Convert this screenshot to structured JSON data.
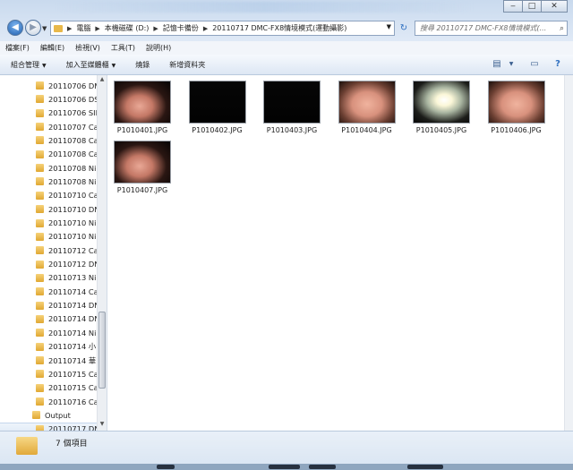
{
  "address": {
    "crumbs": [
      "電腦",
      "本機磁碟 (D:)",
      "記憶卡備份",
      "20110717 DMC-FX8情境模式(運動攝影)"
    ]
  },
  "search": {
    "placeholder": "搜尋 20110717 DMC-FX8情境模式(..."
  },
  "menu": [
    "檔案(F)",
    "編輯(E)",
    "檢視(V)",
    "工具(T)",
    "說明(H)"
  ],
  "toolbar": {
    "organize": "組合管理",
    "add_to_library": "加入至媒體櫃",
    "burn": "燒錄",
    "new_folder": "新增資料夾"
  },
  "tree": [
    "20110706 DM",
    "20110706 DS",
    "20110706 SIF",
    "20110707 Ca",
    "20110708 Ca",
    "20110708 Ca",
    "20110708 Ni",
    "20110708 Ni",
    "20110710 Ca",
    "20110710 DN",
    "20110710 Ni",
    "20110710 Ni",
    "20110712 Ca",
    "20110712 DN",
    "20110713 Ni",
    "20110714 Ca",
    "20110714 DN",
    "20110714 DN",
    "20110714 Ni",
    "20110714 小",
    "20110714 華",
    "20110715 Ca",
    "20110715 Ca",
    "20110716 Ca",
    "Output",
    "20110717 DN"
  ],
  "files": [
    {
      "name": "P1010401.JPG",
      "icon": "photo-hand-dark"
    },
    {
      "name": "P1010402.JPG",
      "icon": "photo-black"
    },
    {
      "name": "P1010403.JPG",
      "icon": "photo-black"
    },
    {
      "name": "P1010404.JPG",
      "icon": "photo-hand-light"
    },
    {
      "name": "P1010405.JPG",
      "icon": "photo-light-bulb"
    },
    {
      "name": "P1010406.JPG",
      "icon": "photo-hand-light"
    },
    {
      "name": "P1010407.JPG",
      "icon": "photo-hand-dark"
    }
  ],
  "status": {
    "count_text": "7 個項目"
  },
  "colors": {
    "accent": "#2e6fc0",
    "folder": "#e8b84a"
  }
}
